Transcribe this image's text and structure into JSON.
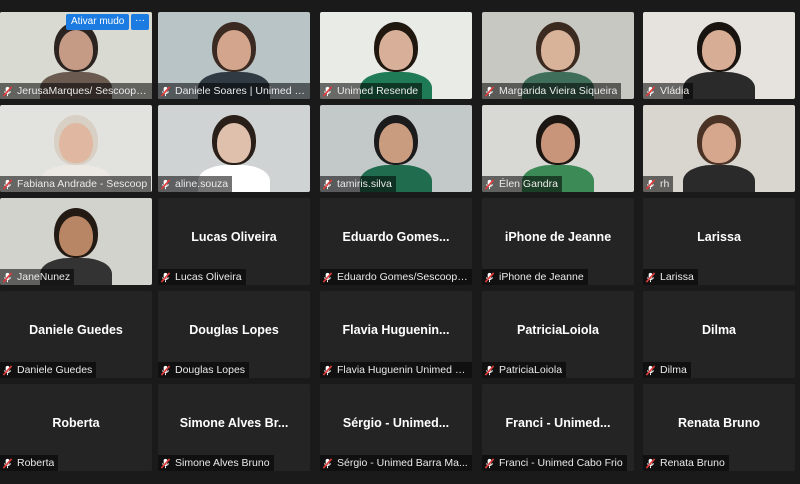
{
  "controls": {
    "unmute_label": "Ativar mudo",
    "more_label": "···"
  },
  "video_tiles": [
    {
      "name": "JerusaMarques/ SescoopRJ",
      "bg": "#d9dbd2",
      "skin": "#c59b86",
      "shirt": "#6a5a50",
      "hair": "#2c2420"
    },
    {
      "name": "Daniele Soares | Unimed P...",
      "bg": "#b9c4c7",
      "skin": "#d2a58c",
      "shirt": "#2f3a43",
      "hair": "#3a2a22"
    },
    {
      "name": "Unimed Resende",
      "bg": "#e8ebe6",
      "skin": "#d8b09a",
      "shirt": "#1f7a56",
      "hair": "#20180f"
    },
    {
      "name": "Margarida Vieira Siqueira",
      "bg": "#c8c8c2",
      "skin": "#d9b29a",
      "shirt": "#3f6f5a",
      "hair": "#3b2a1f"
    },
    {
      "name": "Vládia",
      "bg": "#e6e3de",
      "skin": "#d7ad96",
      "shirt": "#2a2a2a",
      "hair": "#1a1410"
    },
    {
      "name": "Fabiana Andrade - Sescoop",
      "bg": "#e2e2df",
      "skin": "#e0b8a2",
      "shirt": "#ece9e4",
      "hair": "#d8d0c4"
    },
    {
      "name": "aline.souza",
      "bg": "#cfd3d4",
      "skin": "#dfc0ac",
      "shirt": "#ffffff",
      "hair": "#2a1f18"
    },
    {
      "name": "tamiris.silva",
      "bg": "#c3c8c9",
      "skin": "#c99c80",
      "shirt": "#1f6d4e",
      "hair": "#1b1b1b"
    },
    {
      "name": "Élen Gandra",
      "bg": "#d8d9d5",
      "skin": "#c8957a",
      "shirt": "#3c8a56",
      "hair": "#1c1612"
    },
    {
      "name": "rh",
      "bg": "#d9d6cf",
      "skin": "#d6a68d",
      "shirt": "#2a2a2a",
      "hair": "#4a3325"
    },
    {
      "name": "JaneNunez",
      "bg": "#d3d3ce",
      "skin": "#b88565",
      "shirt": "#333333",
      "hair": "#231a14"
    }
  ],
  "name_tiles": [
    {
      "big": "Lucas Oliveira",
      "label": "Lucas Oliveira"
    },
    {
      "big": "Eduardo  Gomes...",
      "label": "Eduardo Gomes/Sescoop/Rj"
    },
    {
      "big": "iPhone de Jeanne",
      "label": "iPhone de Jeanne"
    },
    {
      "big": "Larissa",
      "label": "Larissa"
    },
    {
      "big": "Daniele Guedes",
      "label": "Daniele Guedes"
    },
    {
      "big": "Douglas Lopes",
      "label": "Douglas Lopes"
    },
    {
      "big": "Flavia  Huguenin...",
      "label": "Flavia Huguenin Unimed Se..."
    },
    {
      "big": "PatriciaLoiola",
      "label": "PatriciaLoiola"
    },
    {
      "big": "Dilma",
      "label": "Dilma"
    },
    {
      "big": "Roberta",
      "label": "Roberta"
    },
    {
      "big": "Simone Alves  Br...",
      "label": "Simone Alves Bruno"
    },
    {
      "big": "Sérgio  -  Unimed...",
      "label": "Sérgio - Unimed Barra Ma..."
    },
    {
      "big": "Franci  -  Unimed...",
      "label": "Franci - Unimed Cabo Frio"
    },
    {
      "big": "Renata Bruno",
      "label": "Renata Bruno"
    }
  ],
  "colors": {
    "active_border": "#d8e63a",
    "mute_icon": "#e03a3a",
    "button_blue": "#1b7be0"
  }
}
